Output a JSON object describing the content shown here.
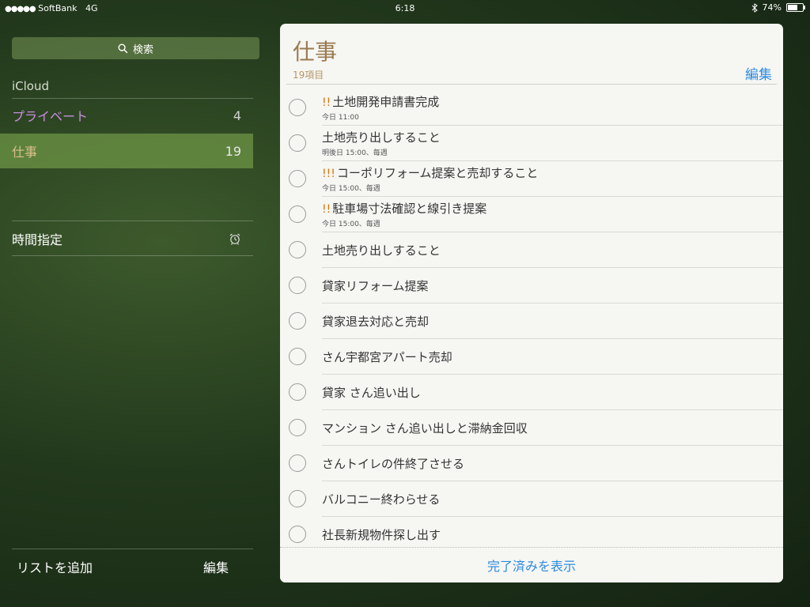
{
  "status": {
    "carrier": "SoftBank",
    "network": "4G",
    "time": "6:18",
    "battery": "74%",
    "battery_level": 0.74
  },
  "sidebar": {
    "search_label": "検索",
    "section": "iCloud",
    "lists": [
      {
        "name": "プライベート",
        "count": "4"
      },
      {
        "name": "仕事",
        "count": "19"
      }
    ],
    "scheduled": "時間指定",
    "add_list": "リストを追加",
    "edit": "編集"
  },
  "panel": {
    "title": "仕事",
    "count": "19項目",
    "edit": "編集",
    "tasks": [
      {
        "priority": "!!",
        "title": "土地開発申請書完成",
        "sub": "今日 11:00"
      },
      {
        "priority": "",
        "title": "土地売り出しすること",
        "sub": "明後日 15:00、毎週"
      },
      {
        "priority": "!!!",
        "title": "コーポリフォーム提案と売却すること",
        "sub": "今日 15:00、毎週"
      },
      {
        "priority": "!!",
        "title": "駐車場寸法確認と線引き提案",
        "sub": "今日 15:00、毎週"
      },
      {
        "priority": "",
        "title": "土地売り出しすること",
        "sub": ""
      },
      {
        "priority": "",
        "title": "貸家リフォーム提案",
        "sub": ""
      },
      {
        "priority": "",
        "title": "貸家退去対応と売却",
        "sub": ""
      },
      {
        "priority": "",
        "title": "さん宇都宮アパート売却",
        "sub": ""
      },
      {
        "priority": "",
        "title": "貸家 さん追い出し",
        "sub": ""
      },
      {
        "priority": "",
        "title": "マンション さん追い出しと滞納金回収",
        "sub": ""
      },
      {
        "priority": "",
        "title": "さんトイレの件終了させる",
        "sub": ""
      },
      {
        "priority": "",
        "title": "バルコニー終わらせる",
        "sub": ""
      },
      {
        "priority": "",
        "title": "社長新規物件探し出す",
        "sub": ""
      }
    ],
    "show_completed": "完了済みを表示"
  }
}
